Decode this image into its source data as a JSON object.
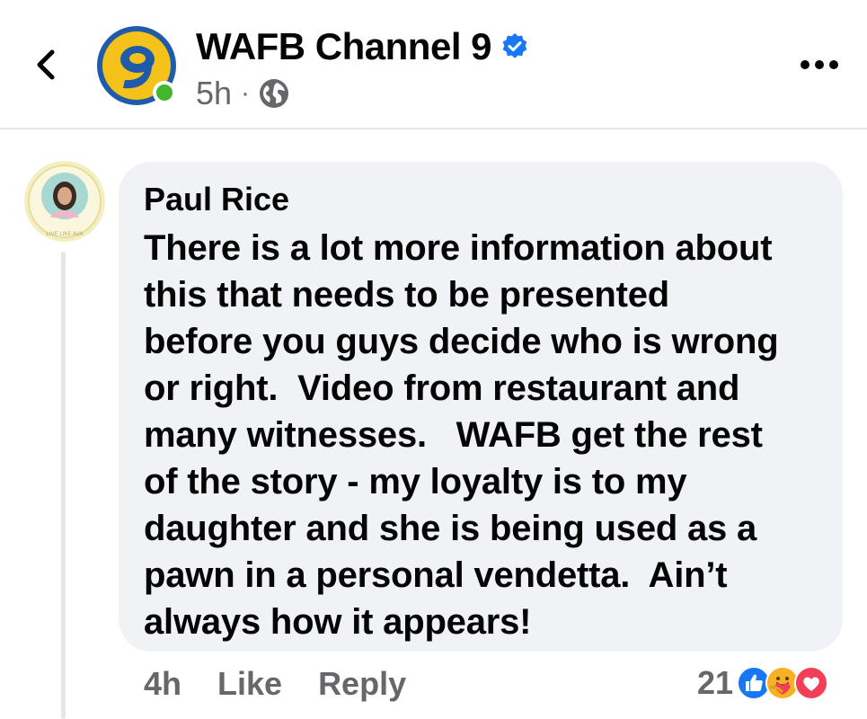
{
  "header": {
    "page_name": "WAFB Channel 9",
    "avatar_text": "9",
    "post_time": "5h",
    "separator": "·",
    "icons": {
      "back": "chevron-left-icon",
      "verified": "verified-check-icon",
      "audience": "globe-icon",
      "more": "more-dots-icon"
    }
  },
  "comment": {
    "author": "Paul Rice",
    "avatar_caption": "LIVE LIKE AVA",
    "text": "There is a lot more information about\nthis that needs to be presented\nbefore you guys decide who is wrong\nor right.  Video from restaurant and\nmany witnesses.   WAFB get the rest\nof the story - my loyalty is to my\ndaughter and she is being used as a\npawn in a personal vendetta.  Ain’t\nalways how it appears!",
    "time": "4h",
    "like_label": "Like",
    "reply_label": "Reply",
    "reaction_count": "21",
    "reactions": [
      "like-reaction-icon",
      "care-reaction-icon",
      "love-reaction-icon"
    ]
  },
  "colors": {
    "brand_blue": "#1877f2",
    "online_green": "#42b72a",
    "bubble_bg": "#f0f2f5",
    "secondary_text": "#65676b",
    "love_red": "#f33e58"
  }
}
